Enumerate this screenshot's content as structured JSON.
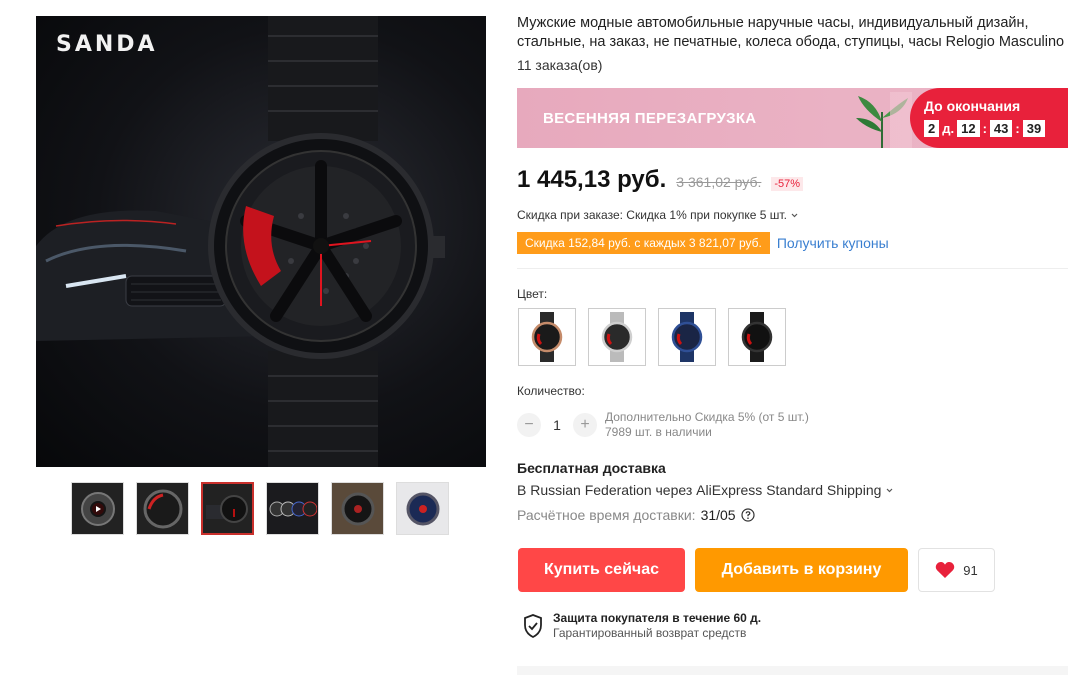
{
  "gallery": {
    "brand": "SANDA",
    "thumbnails": [
      {
        "name": "thumb-video",
        "has_play": true
      },
      {
        "name": "thumb-2",
        "has_play": false
      },
      {
        "name": "thumb-3",
        "has_play": false,
        "active": true
      },
      {
        "name": "thumb-4",
        "has_play": false
      },
      {
        "name": "thumb-5",
        "has_play": false
      },
      {
        "name": "thumb-6",
        "has_play": false
      }
    ]
  },
  "product": {
    "title": "Мужские модные автомобильные наручные часы, индивидуальный дизайн, стальные, на заказ, не печатные, колеса обода, ступицы, часы Relogio Masculino",
    "orders": "11 заказа(ов)"
  },
  "promo": {
    "title": "ВЕСЕННЯЯ ПЕРЕЗАГРУЗКА",
    "countdown_label": "До окончания",
    "days": "2",
    "days_unit": "д.",
    "hours": "12",
    "minutes": "43",
    "seconds": "39"
  },
  "price": {
    "current": "1 445,13 руб.",
    "old": "3 361,02 руб.",
    "discount": "-57%"
  },
  "coupons": {
    "order_discount": "Скидка при заказе: Скидка 1% при покупке 5 шт.",
    "tag": "Скидка 152,84 руб. с каждых 3 821,07 руб.",
    "link": "Получить купоны"
  },
  "color": {
    "label": "Цвет:",
    "options": [
      "rose-gold",
      "silver",
      "blue",
      "black"
    ]
  },
  "quantity": {
    "label": "Количество:",
    "minus": "−",
    "value": "1",
    "plus": "+",
    "extra_discount": "Дополнительно Скидка 5% (от 5 шт.)",
    "stock": "7989 шт. в наличии"
  },
  "shipping": {
    "title": "Бесплатная доставка",
    "via": "В Russian Federation через AliExpress Standard Shipping",
    "eta_label": "Расчётное время доставки:",
    "eta_date": "31/05"
  },
  "actions": {
    "buy": "Купить сейчас",
    "cart": "Добавить в корзину",
    "wishlist_count": "91"
  },
  "protection": {
    "title": "Защита покупателя в течение 60 д.",
    "subtitle": "Гарантированный возврат средств"
  },
  "colors": {
    "buy": "#ff4747",
    "cart": "#ff9900",
    "promo_red": "#e8213b",
    "coupon_orange": "#ff9c1a",
    "link_blue": "#3a7fd0"
  }
}
